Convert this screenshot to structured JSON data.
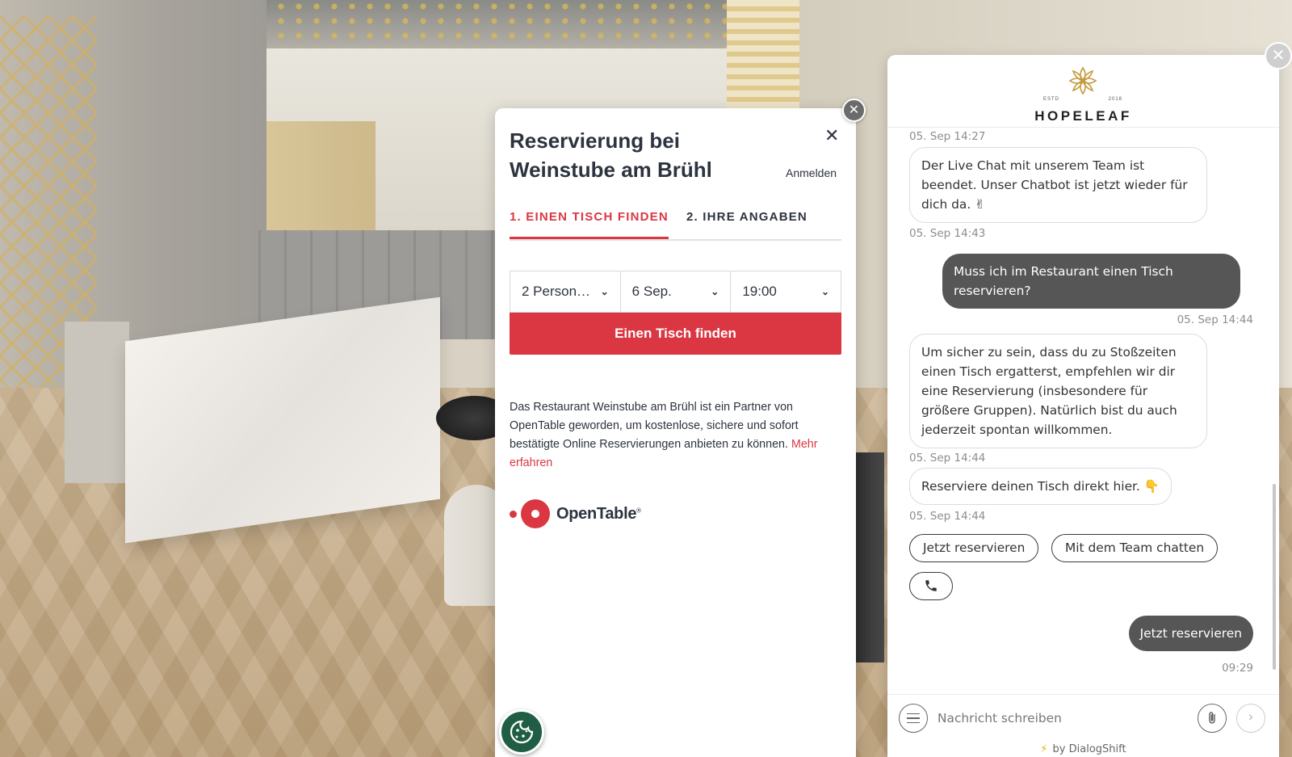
{
  "reservation": {
    "title": "Reservierung bei Weinstube am Brühl",
    "close_symbol": "✕",
    "login_label": "Anmelden",
    "tabs": [
      {
        "label": "1. EINEN TISCH FINDEN"
      },
      {
        "label": "2. IHRE ANGABEN"
      }
    ],
    "selects": {
      "party": "2 Person…",
      "date": "6 Sep.",
      "time": "19:00"
    },
    "find_button": "Einen Tisch finden",
    "info_text": "Das Restaurant Weinstube am Brühl ist ein Partner von OpenTable geworden, um kostenlose, sichere und sofort bestätigte Online Reservierungen anbieten zu können.",
    "info_link": "Mehr erfahren",
    "brand": "OpenTable",
    "brand_mark": "®",
    "accent_color": "#da3743"
  },
  "chat": {
    "brand": {
      "estd": "ESTD",
      "year": "2018",
      "name": "HOPELEAF"
    },
    "messages": [
      {
        "time": "05. Sep 14:27"
      },
      {
        "from": "bot",
        "text": "Der Live Chat mit unserem Team ist beendet. Unser Chatbot ist jetzt wieder für dich da. ✌",
        "time": "05. Sep 14:43"
      },
      {
        "from": "user",
        "text": "Muss ich im Restaurant einen Tisch reservieren?",
        "time": "05. Sep 14:44"
      },
      {
        "from": "bot",
        "text": "Um sicher zu sein, dass du zu Stoßzeiten einen Tisch ergatterst, empfehlen wir dir eine Reservierung (insbesondere für größere Gruppen). Natürlich bist du auch jederzeit spontan willkommen.",
        "time": "05. Sep 14:44"
      },
      {
        "from": "bot",
        "text": "Reserviere deinen Tisch direkt hier. 👇",
        "time": "05. Sep 14:44"
      },
      {
        "from": "user",
        "text": "Jetzt reservieren",
        "time": "09:29"
      }
    ],
    "quick_replies": [
      "Jetzt reservieren",
      "Mit dem Team chatten"
    ],
    "input_placeholder": "Nachricht schreiben",
    "powered_by": "by DialogShift",
    "icons": [
      "menu-icon",
      "paperclip-icon",
      "send-arrow-icon",
      "phone-icon",
      "close-icon",
      "cookie-icon",
      "lightning-icon"
    ]
  }
}
